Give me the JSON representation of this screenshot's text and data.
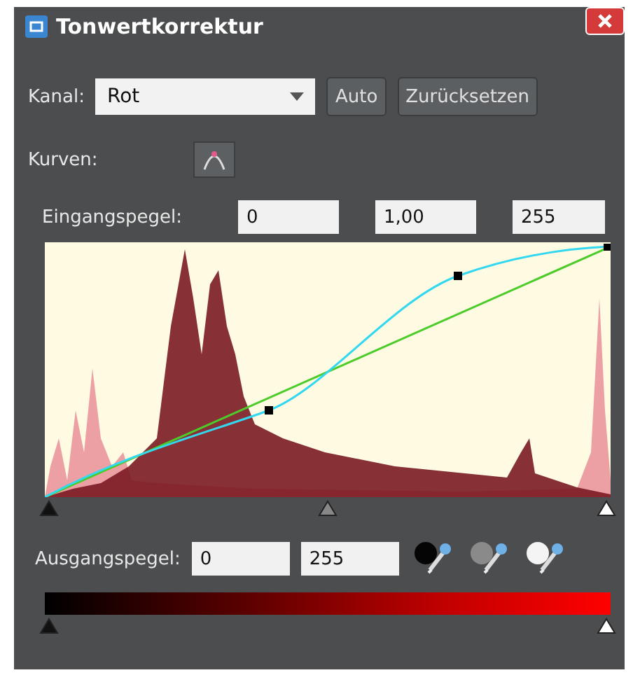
{
  "window": {
    "title": "Tonwertkorrektur"
  },
  "channel": {
    "label": "Kanal:",
    "value": "Rot"
  },
  "buttons": [
    {
      "label": "Auto"
    },
    {
      "label": "Zurücksetzen"
    }
  ],
  "curves": {
    "label": "Kurven:"
  },
  "input_levels": {
    "label": "Eingangspegel:",
    "values": [
      "0",
      "1,00",
      "255"
    ]
  },
  "output_levels": {
    "label": "Ausgangspegel:",
    "values": [
      "0",
      "255"
    ]
  }
}
